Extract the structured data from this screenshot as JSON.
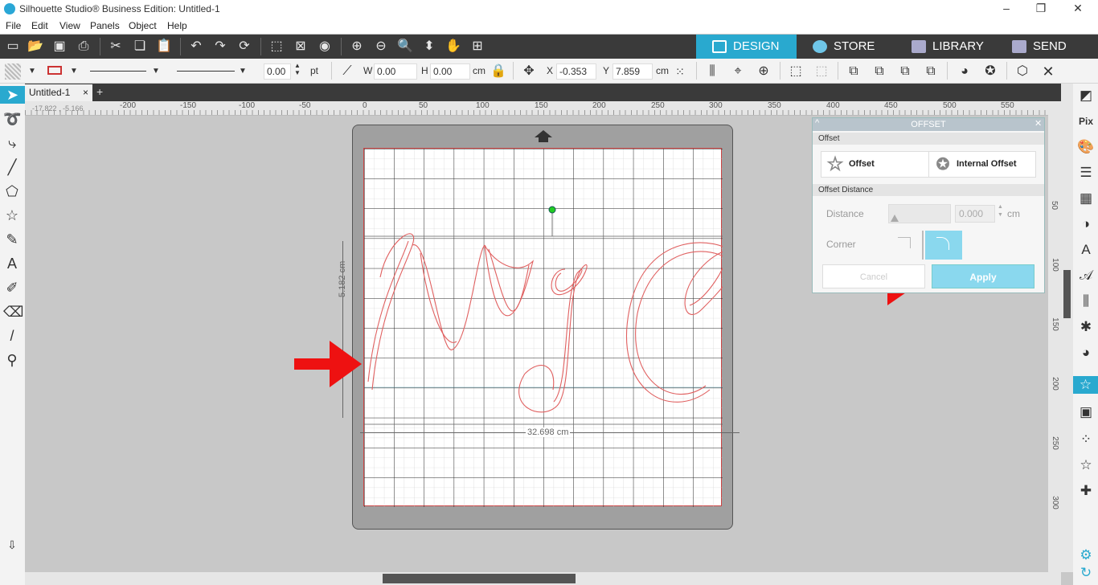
{
  "window": {
    "title": "Silhouette Studio® Business Edition: Untitled-1"
  },
  "menu": [
    "File",
    "Edit",
    "View",
    "Panels",
    "Object",
    "Help"
  ],
  "tabs": [
    {
      "label": "DESIGN",
      "icon": "grid-icon",
      "active": true
    },
    {
      "label": "STORE",
      "icon": "store-icon",
      "active": false
    },
    {
      "label": "LIBRARY",
      "icon": "library-icon",
      "active": false
    },
    {
      "label": "SEND",
      "icon": "send-icon",
      "active": false
    }
  ],
  "toolbar2": {
    "stroke_weight": "0.00",
    "stroke_unit": "pt",
    "w_label": "W",
    "w_value": "0.00",
    "h_label": "H",
    "h_value": "0.00",
    "size_unit": "cm",
    "x_label": "X",
    "x_value": "-0.353",
    "y_label": "Y",
    "y_value": "7.859",
    "pos_unit": "cm"
  },
  "document": {
    "tab_label": "Untitled-1",
    "close": "×",
    "add": "+"
  },
  "ruler": {
    "coords": "-17.822 , -5.166",
    "h_ticks": [
      "-200",
      "-150",
      "-100",
      "-50",
      "0",
      "50",
      "100",
      "150",
      "200",
      "250",
      "300",
      "350",
      "400",
      "450",
      "500",
      "550"
    ],
    "v_ticks": [
      "50",
      "100",
      "150",
      "200",
      "250",
      "300"
    ]
  },
  "canvas": {
    "height_dim": "5.182 cm",
    "width_dim": "32.698 cm"
  },
  "offset_panel": {
    "title": "OFFSET",
    "section_offset": "Offset",
    "offset_button": "Offset",
    "internal_offset_button": "Internal Offset",
    "section_distance": "Offset Distance",
    "distance_label": "Distance",
    "distance_value": "0.000",
    "distance_unit": "cm",
    "corner_label": "Corner",
    "cancel_label": "Cancel",
    "apply_label": "Apply"
  },
  "colors": {
    "accent": "#29a9cf",
    "arrow": "#ee1111",
    "design_red": "#e06060"
  }
}
